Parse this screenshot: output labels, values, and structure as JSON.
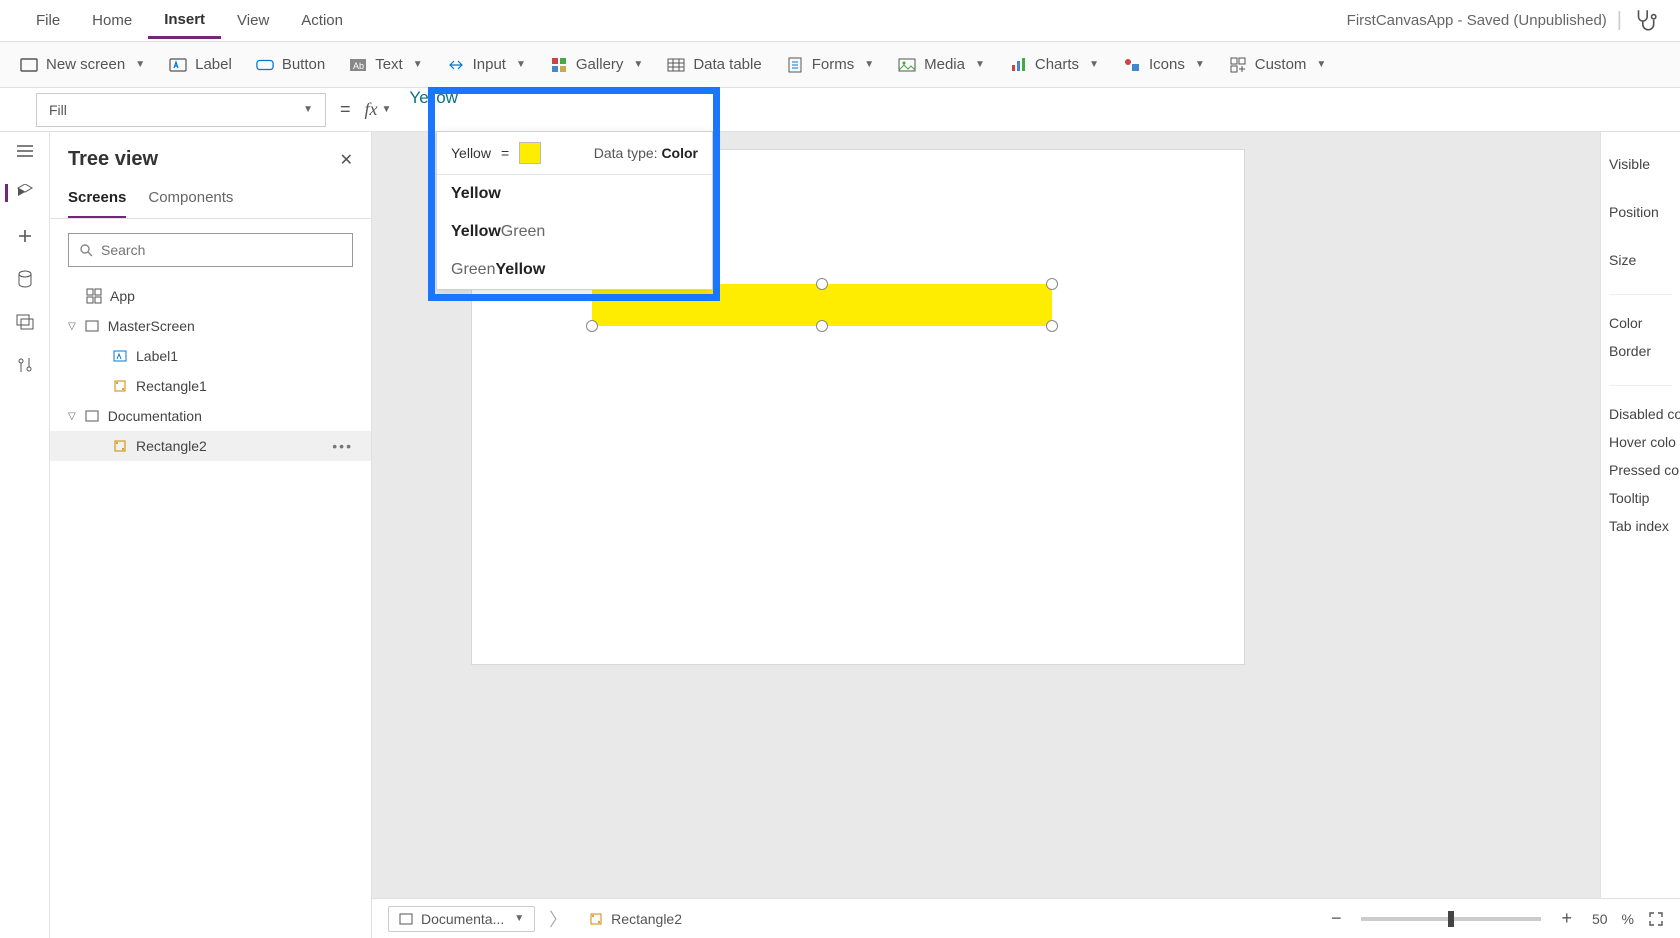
{
  "app_title": "FirstCanvasApp - Saved (Unpublished)",
  "menu": {
    "file": "File",
    "home": "Home",
    "insert": "Insert",
    "view": "View",
    "action": "Action",
    "active": "insert"
  },
  "ribbon": {
    "new_screen": "New screen",
    "label": "Label",
    "button": "Button",
    "text": "Text",
    "input": "Input",
    "gallery": "Gallery",
    "data_table": "Data table",
    "forms": "Forms",
    "media": "Media",
    "charts": "Charts",
    "icons": "Icons",
    "custom": "Custom"
  },
  "formula": {
    "property": "Fill",
    "value": "Yellow"
  },
  "autocomplete": {
    "eval_label": "Yellow",
    "eval_eq": "=",
    "swatch_color": "#ffed00",
    "datatype_label": "Data type:",
    "datatype_value": "Color",
    "items": [
      {
        "pre": "",
        "match": "Yellow",
        "post": ""
      },
      {
        "pre": "",
        "match": "Yellow",
        "post": "Green"
      },
      {
        "pre": "Green",
        "match": "Yellow",
        "post": ""
      }
    ]
  },
  "tree": {
    "title": "Tree view",
    "tabs": {
      "screens": "Screens",
      "components": "Components",
      "active": "screens"
    },
    "search_placeholder": "Search",
    "rows": [
      {
        "id": "app",
        "label": "App",
        "type": "app",
        "indent": 0
      },
      {
        "id": "master",
        "label": "MasterScreen",
        "type": "screen",
        "indent": 0,
        "expanded": true
      },
      {
        "id": "label1",
        "label": "Label1",
        "type": "label",
        "indent": 1
      },
      {
        "id": "rect1",
        "label": "Rectangle1",
        "type": "rect",
        "indent": 1
      },
      {
        "id": "doc",
        "label": "Documentation",
        "type": "screen",
        "indent": 0,
        "expanded": true
      },
      {
        "id": "rect2",
        "label": "Rectangle2",
        "type": "rect",
        "indent": 1,
        "selected": true
      }
    ]
  },
  "props": {
    "visible": "Visible",
    "position": "Position",
    "size": "Size",
    "color": "Color",
    "border": "Border",
    "disabled": "Disabled co",
    "hover": "Hover colo",
    "pressed": "Pressed co",
    "tooltip": "Tooltip",
    "tabindex": "Tab index"
  },
  "bottom": {
    "crumb1": "Documenta...",
    "crumb2": "Rectangle2",
    "zoom_value": "50",
    "zoom_pct": "%"
  }
}
